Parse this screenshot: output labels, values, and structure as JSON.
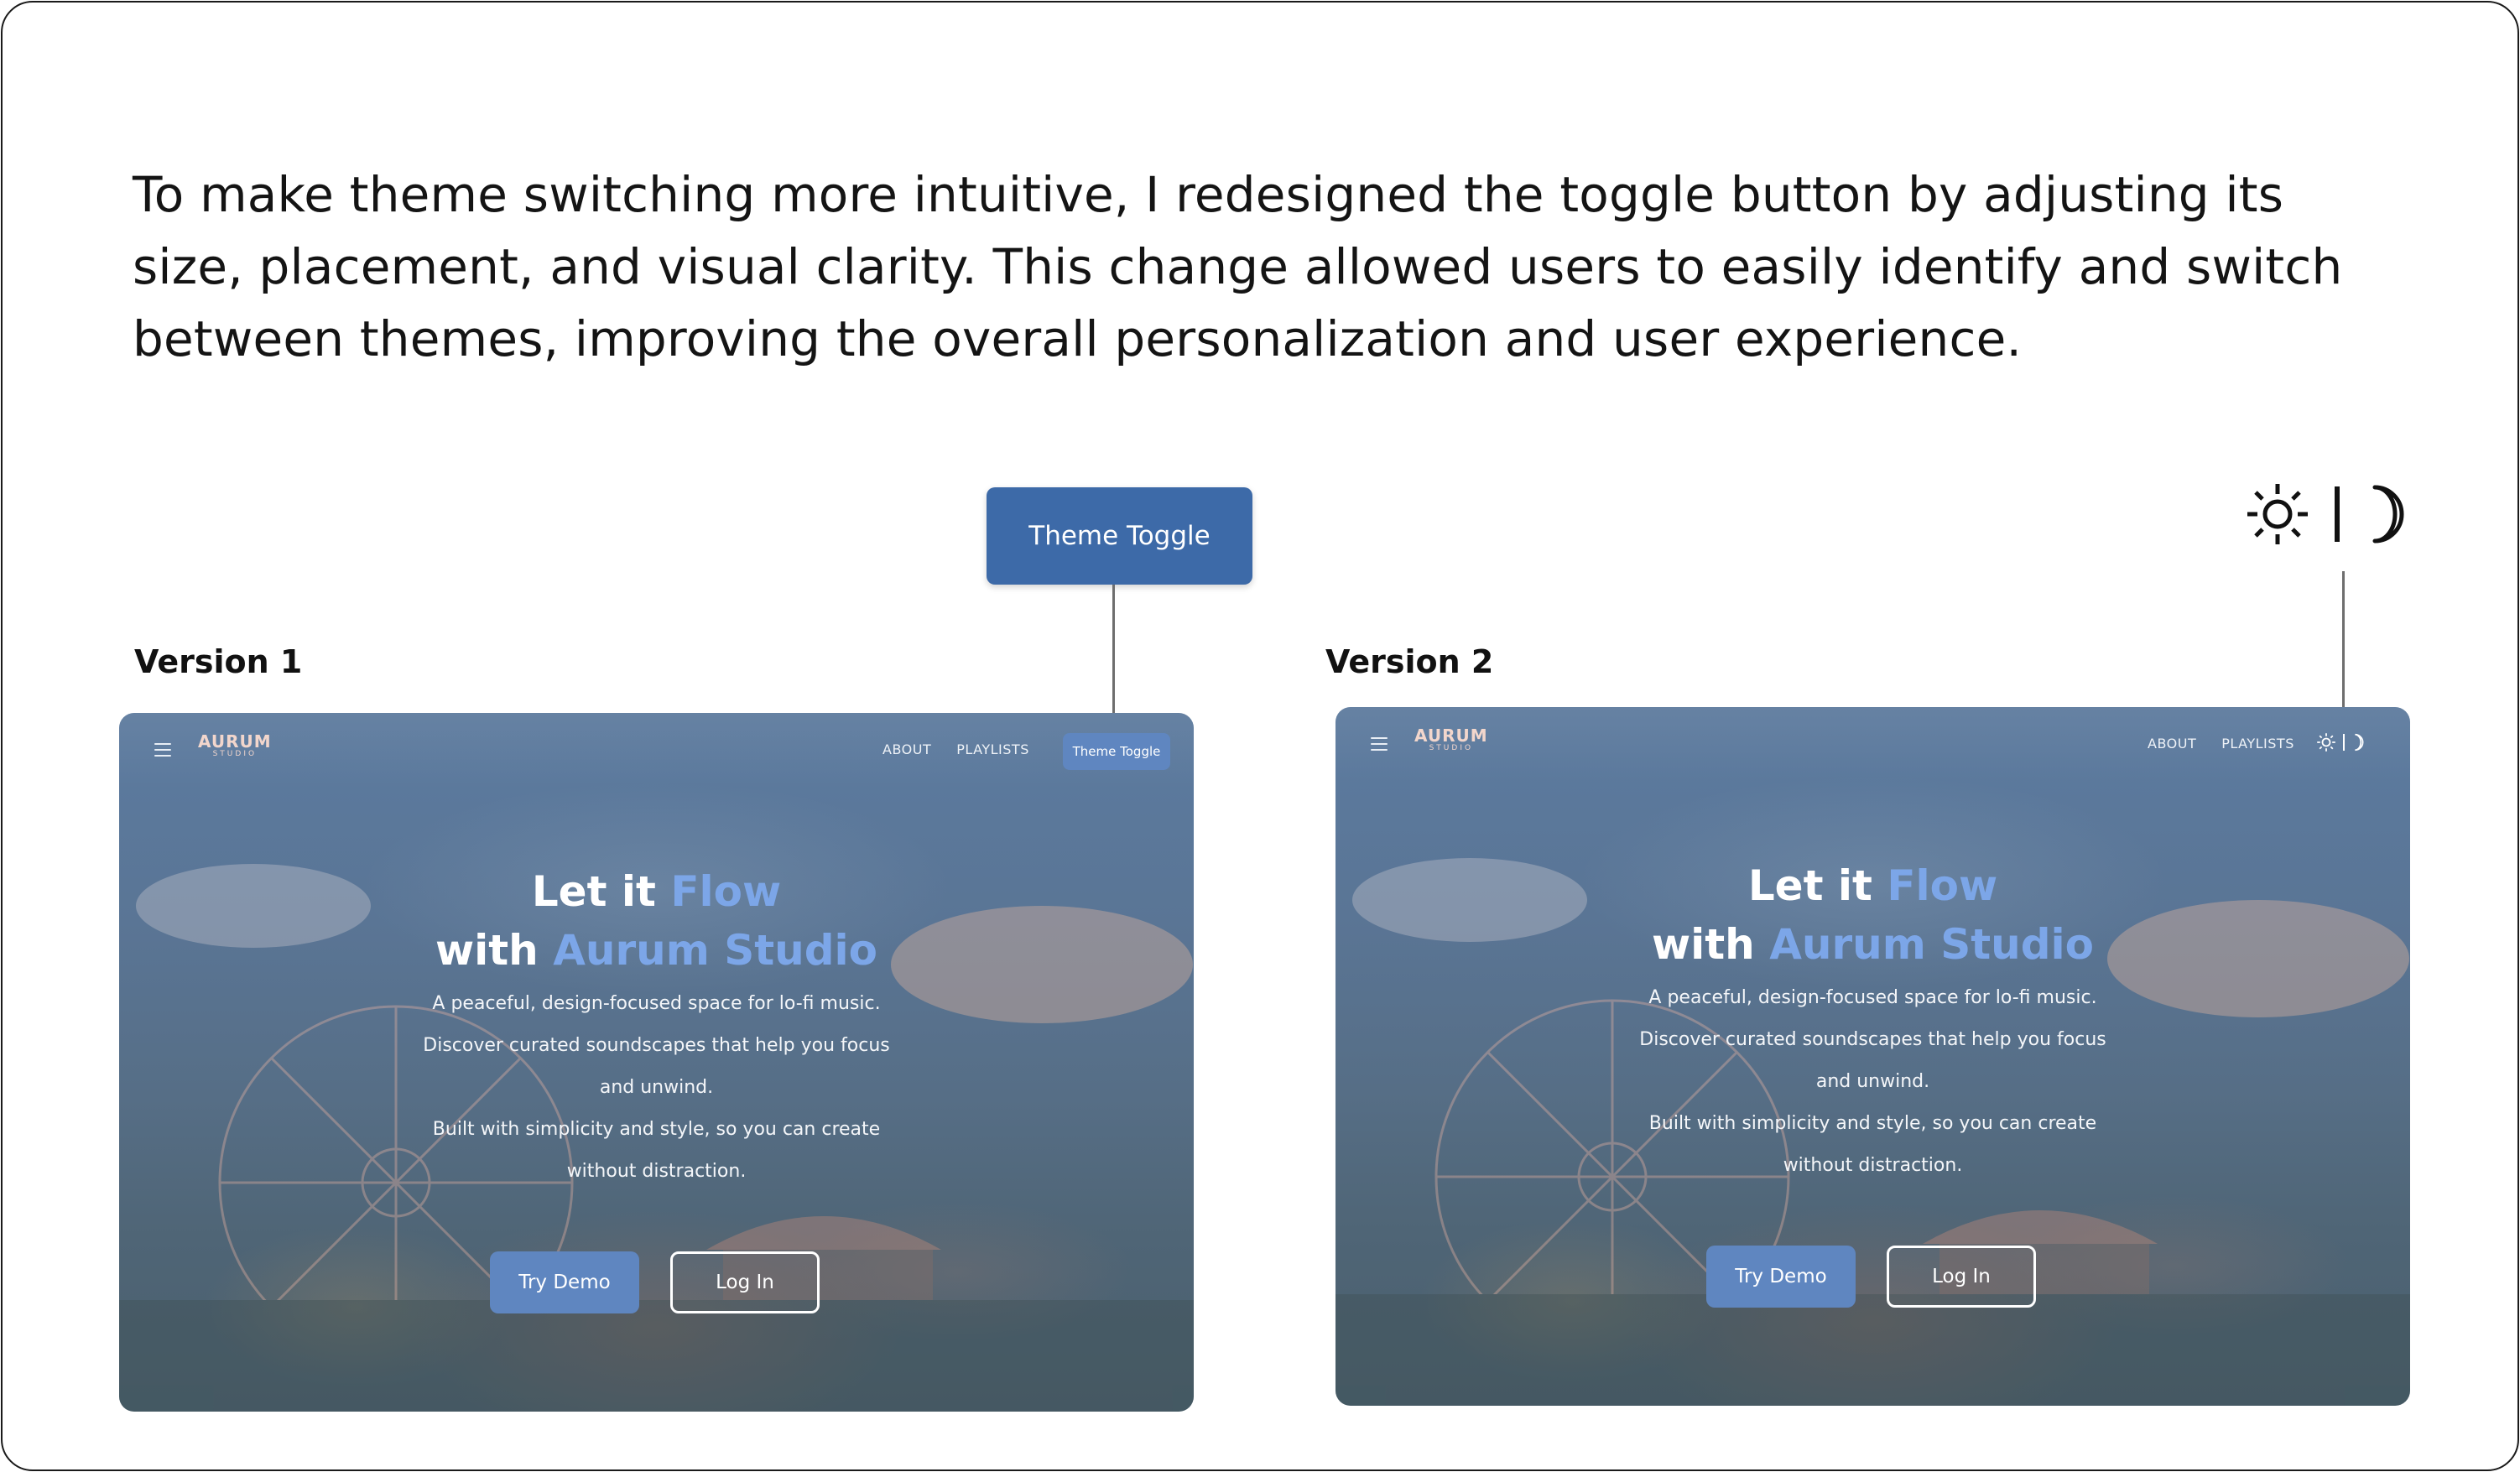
{
  "intro": {
    "text": "To make theme switching more intuitive, I redesigned the toggle button by adjusting its size, placement, and visual clarity. This change allowed users to easily identify and switch between themes, improving the overall personalization and user experience."
  },
  "callouts": {
    "v1_label": "Theme Toggle",
    "v2_icons": [
      "sun-icon",
      "divider",
      "moon-icon"
    ]
  },
  "versions": [
    {
      "label": "Version 1",
      "screen": {
        "logo_main": "AURUM",
        "logo_sub": "STUDIO",
        "nav": [
          "ABOUT",
          "PLAYLISTS"
        ],
        "theme_toggle_label": "Theme Toggle",
        "hero_title_a": "Let it ",
        "hero_title_accent_a": "Flow",
        "hero_title_b": "with ",
        "hero_title_accent_b": "Aurum Studio",
        "desc_lines": [
          "A peaceful, design-focused space for lo-fi music.",
          "Discover curated soundscapes that help you focus",
          "and unwind.",
          "Built with simplicity and style, so you can create",
          "without distraction."
        ],
        "primary_button": "Try Demo",
        "secondary_button": "Log In"
      }
    },
    {
      "label": "Version 2",
      "screen": {
        "logo_main": "AURUM",
        "logo_sub": "STUDIO",
        "nav": [
          "ABOUT",
          "PLAYLISTS"
        ],
        "theme_icons": [
          "sun-icon",
          "moon-icon"
        ],
        "hero_title_a": "Let it ",
        "hero_title_accent_a": "Flow",
        "hero_title_b": "with ",
        "hero_title_accent_b": "Aurum Studio",
        "desc_lines": [
          "A peaceful, design-focused space for lo-fi music.",
          "Discover curated soundscapes that help you focus",
          "and unwind.",
          "Built with simplicity and style, so you can create",
          "without distraction."
        ],
        "primary_button": "Try Demo",
        "secondary_button": "Log In"
      }
    }
  ],
  "colors": {
    "accent_blue": "#3d6aa8",
    "hero_accent": "#7ca6e8",
    "button_blue": "#5f86c0",
    "logo_pink": "#f2d6cc"
  }
}
